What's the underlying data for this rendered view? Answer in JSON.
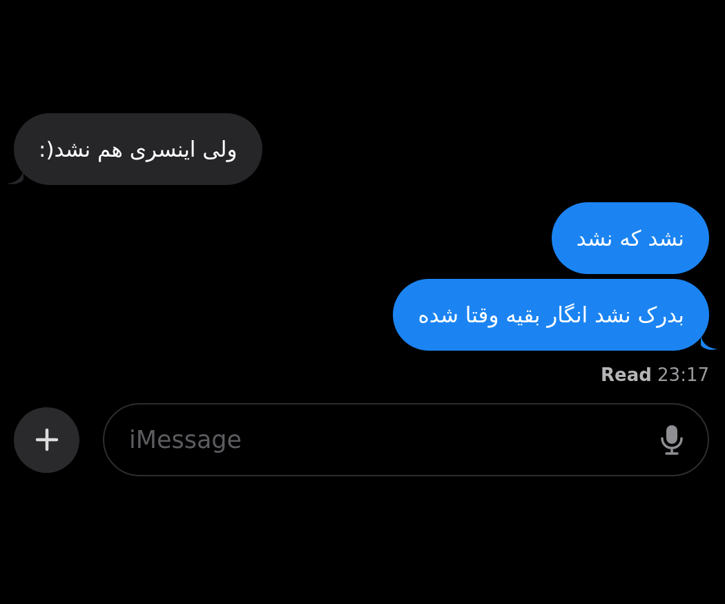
{
  "messages": [
    {
      "kind": "incoming",
      "text": "ولی اینسری هم نشد(:",
      "tail": true
    },
    {
      "kind": "outgoing",
      "text": "نشد که نشد",
      "tail": false
    },
    {
      "kind": "outgoing",
      "text": "بدرک نشد انگار بقیه وقتا شده",
      "tail": true
    }
  ],
  "receipt": "**Read** 23:17",
  "composer": {
    "placeholder": "iMessage"
  }
}
